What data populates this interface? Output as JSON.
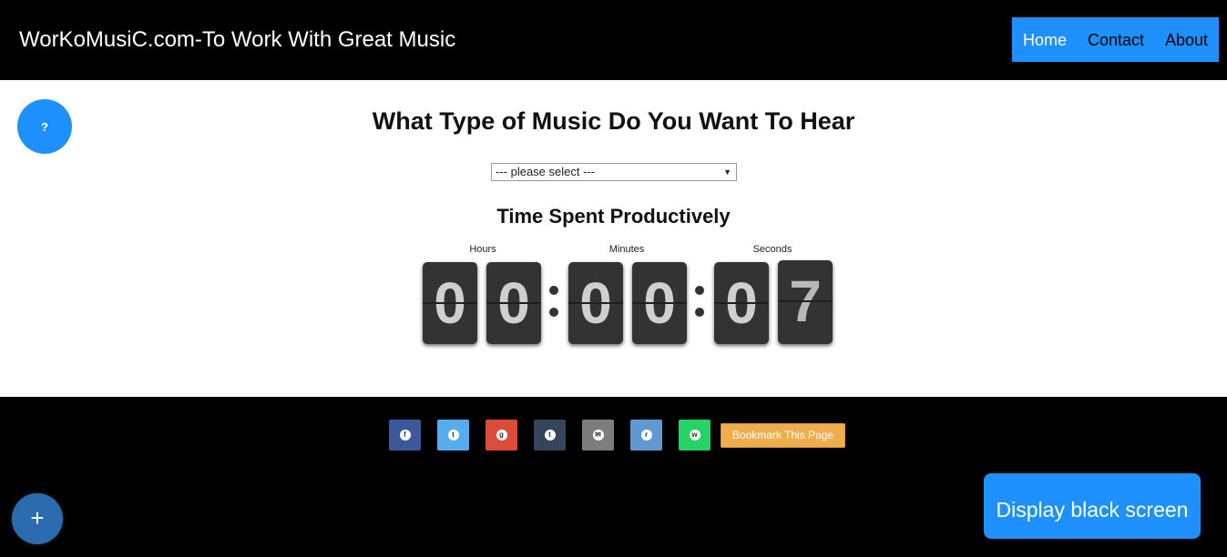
{
  "header": {
    "title": "WorKoMusiC.com-To Work With Great Music",
    "nav": [
      {
        "label": "Home",
        "active": true
      },
      {
        "label": "Contact",
        "active": false
      },
      {
        "label": "About",
        "active": false
      }
    ]
  },
  "main": {
    "help_label": "?",
    "heading": "What Type of Music Do You Want To Hear",
    "select": {
      "value": "--- please select ---",
      "caret": "▼"
    },
    "subheading": "Time Spent Productively",
    "timer": {
      "labels": {
        "hours": "Hours",
        "minutes": "Minutes",
        "seconds": "Seconds"
      },
      "digits": [
        "0",
        "0",
        "0",
        "0",
        "0",
        "7"
      ]
    }
  },
  "footer": {
    "share_buttons": [
      {
        "name": "facebook",
        "glyph": "f",
        "color": "#3b5998"
      },
      {
        "name": "twitter",
        "glyph": "t",
        "color": "#55acee"
      },
      {
        "name": "google-plus",
        "glyph": "g",
        "color": "#dd4b39"
      },
      {
        "name": "tumblr",
        "glyph": "t",
        "color": "#35465c"
      },
      {
        "name": "email",
        "glyph": "✉",
        "color": "#7d7d7d"
      },
      {
        "name": "reddit",
        "glyph": "r",
        "color": "#5f99cf"
      },
      {
        "name": "whatsapp",
        "glyph": "w",
        "color": "#25d366"
      }
    ],
    "bookmark_label": "Bookmark This Page"
  },
  "floating": {
    "plus_label": "+",
    "black_screen_label": "Display black screen"
  },
  "colors": {
    "accent": "#1e90ff",
    "bookmark": "#f0ad4e",
    "plus_button": "#2b6cb0"
  }
}
